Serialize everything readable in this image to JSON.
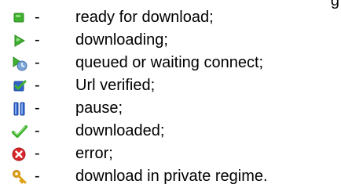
{
  "header_fragment": "g",
  "items": [
    {
      "icon": "green-square-icon",
      "dash": "-",
      "label": "ready for download;"
    },
    {
      "icon": "green-play-icon",
      "dash": "-",
      "label": "downloading;"
    },
    {
      "icon": "queued-arrow-icon",
      "dash": "-",
      "label": "queued or waiting connect;"
    },
    {
      "icon": "blue-check-icon",
      "dash": "-",
      "label": "Url verified;"
    },
    {
      "icon": "pause-icon",
      "dash": "-",
      "label": "pause;"
    },
    {
      "icon": "green-checkmark-icon",
      "dash": "-",
      "label": "downloaded;"
    },
    {
      "icon": "red-error-icon",
      "dash": "-",
      "label": "error;"
    },
    {
      "icon": "key-icon",
      "dash": "-",
      "label": "download in private regime."
    }
  ],
  "colors": {
    "text": "#000000",
    "green": "#3fb030",
    "blue": "#2f62c8",
    "red": "#d8262a",
    "gold": "#e0a21a"
  }
}
